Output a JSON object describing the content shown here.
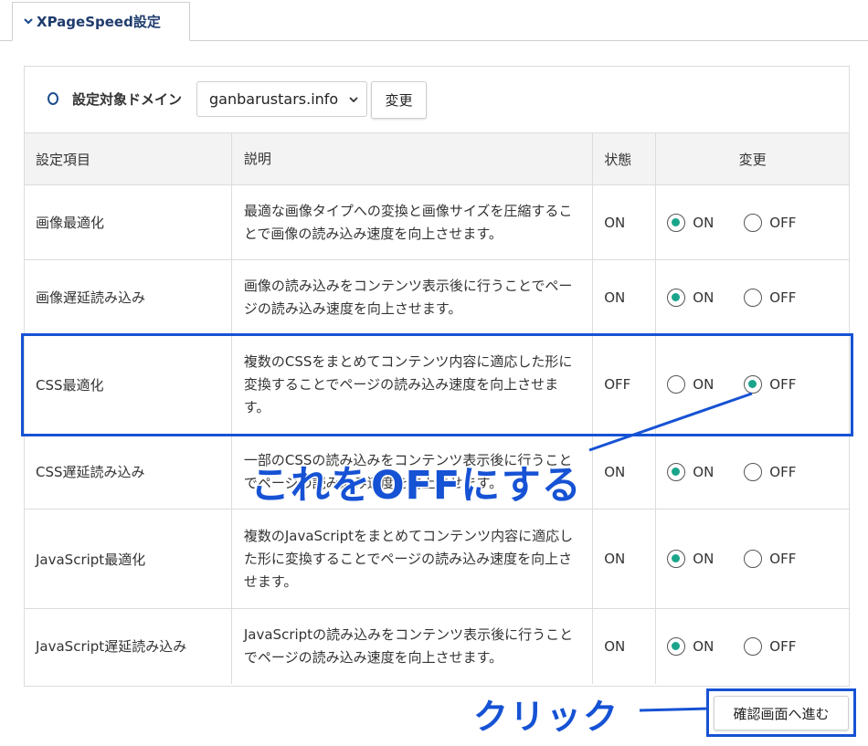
{
  "tab": {
    "label": "XPageSpeed設定"
  },
  "domain": {
    "label": "設定対象ドメイン",
    "selected": "ganbarustars.info",
    "change_button": "変更"
  },
  "table": {
    "headers": [
      "設定項目",
      "説明",
      "状態",
      "変更"
    ],
    "rows": [
      {
        "item": "画像最適化",
        "desc": "最適な画像タイプへの変換と画像サイズを圧縮することで画像の読み込み速度を向上させます。",
        "status": "ON",
        "on_label": "ON",
        "off_label": "OFF",
        "selected": "ON"
      },
      {
        "item": "画像遅延読み込み",
        "desc": "画像の読み込みをコンテンツ表示後に行うことでページの読み込み速度を向上させます。",
        "status": "ON",
        "on_label": "ON",
        "off_label": "OFF",
        "selected": "ON"
      },
      {
        "item": "CSS最適化",
        "desc": "複数のCSSをまとめてコンテンツ内容に適応した形に変換することでページの読み込み速度を向上させます。",
        "status": "OFF",
        "on_label": "ON",
        "off_label": "OFF",
        "selected": "OFF"
      },
      {
        "item": "CSS遅延読み込み",
        "desc": "一部のCSSの読み込みをコンテンツ表示後に行うことでページの読み込み速度を向上させます。",
        "status": "ON",
        "on_label": "ON",
        "off_label": "OFF",
        "selected": "ON"
      },
      {
        "item": "JavaScript最適化",
        "desc": "複数のJavaScriptをまとめてコンテンツ内容に適応した形に変換することでページの読み込み速度を向上させます。",
        "status": "ON",
        "on_label": "ON",
        "off_label": "OFF",
        "selected": "ON"
      },
      {
        "item": "JavaScript遅延読み込み",
        "desc": "JavaScriptの読み込みをコンテンツ表示後に行うことでページの読み込み速度を向上させます。",
        "status": "ON",
        "on_label": "ON",
        "off_label": "OFF",
        "selected": "ON"
      }
    ]
  },
  "annotations": {
    "off_callout": "これをOFFにする",
    "click_callout": "クリック",
    "color": "#1652d4"
  },
  "confirm_button": "確認画面へ進む",
  "colors": {
    "radio_selected": "#1aa58b",
    "tab_text": "#1f3c6e"
  }
}
